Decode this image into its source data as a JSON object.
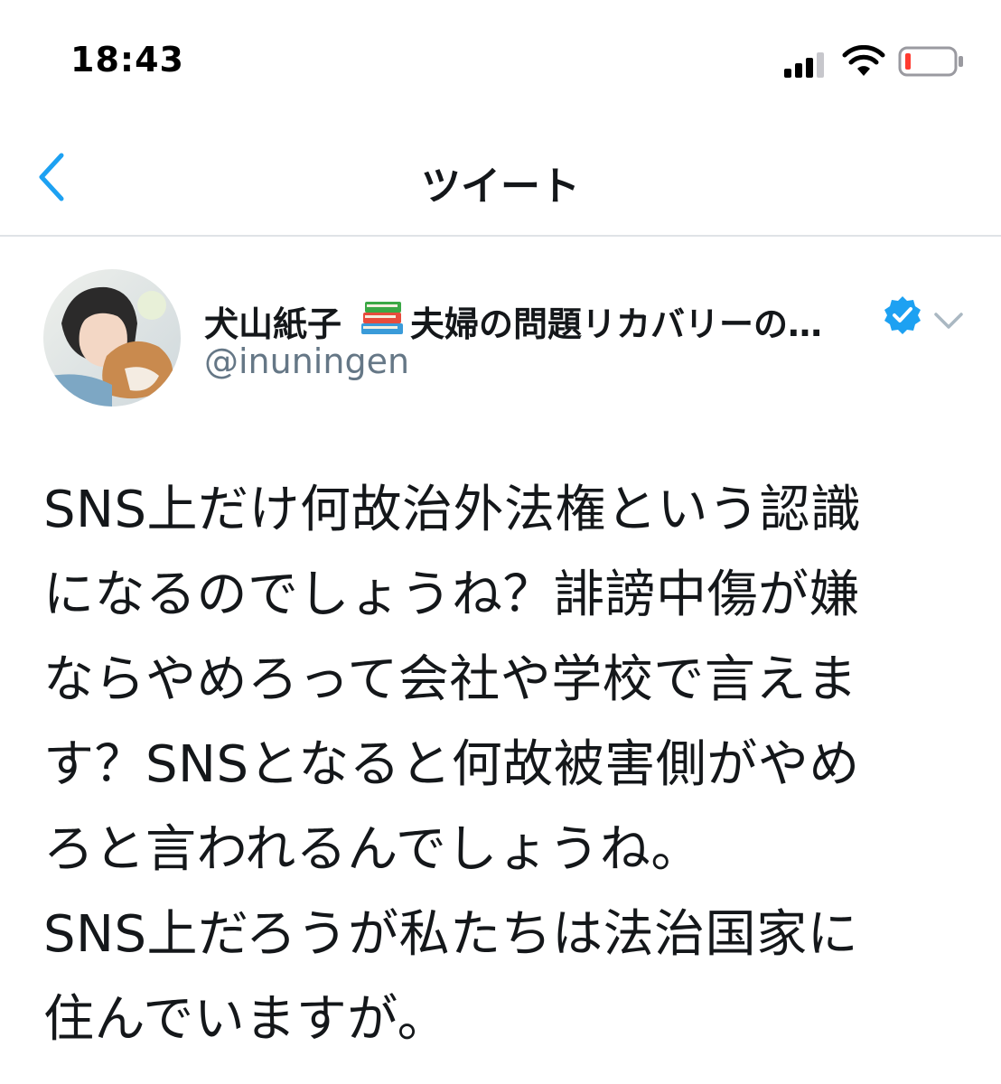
{
  "status_bar": {
    "time": "18:43",
    "signal_icon": "signal-bars-icon",
    "wifi_icon": "wifi-icon",
    "battery_icon": "battery-low-icon",
    "battery_color": "#ff3b30"
  },
  "nav": {
    "back_icon": "chevron-left-icon",
    "title": "ツイート",
    "accent": "#1da1f2"
  },
  "tweet": {
    "display_name_start": "犬山紙子",
    "display_name_end": "夫婦の問題リカバリーの…",
    "name_emoji_icon": "books-icon",
    "verified_icon": "verified-badge-icon",
    "handle": "@inuningen",
    "menu_icon": "chevron-down-icon",
    "text_lines": [
      "SNS上だけ何故治外法権という認識",
      "になるのでしょうね？誹謗中傷が嫌",
      "ならやめろって会社や学校で言えま",
      "す？SNSとなると何故被害側がやめ",
      "ろと言われるんでしょうね。",
      "SNS上だろうが私たちは法治国家に",
      "住んでいますが。"
    ]
  }
}
